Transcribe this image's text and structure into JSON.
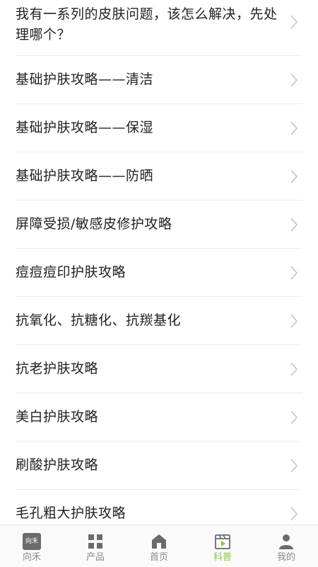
{
  "list": {
    "items": [
      {
        "label": "我有一系列的皮肤问题，该怎么解决，先处理哪个？"
      },
      {
        "label": "基础护肤攻略——清洁"
      },
      {
        "label": "基础护肤攻略——保湿"
      },
      {
        "label": "基础护肤攻略——防晒"
      },
      {
        "label": "屏障受损/敏感皮修护攻略"
      },
      {
        "label": "痘痘痘印护肤攻略"
      },
      {
        "label": "抗氧化、抗糖化、抗羰基化"
      },
      {
        "label": "抗老护肤攻略"
      },
      {
        "label": "美白护肤攻略"
      },
      {
        "label": "刷酸护肤攻略"
      },
      {
        "label": "毛孔粗大护肤攻略"
      }
    ]
  },
  "tabbar": {
    "logo_text": "向禾",
    "tabs": [
      {
        "label": "向禾",
        "icon": "logo-icon"
      },
      {
        "label": "产品",
        "icon": "grid-icon"
      },
      {
        "label": "首页",
        "icon": "home-icon"
      },
      {
        "label": "科普",
        "icon": "clapper-icon"
      },
      {
        "label": "我的",
        "icon": "person-icon"
      }
    ]
  },
  "colors": {
    "active": "#8cc63f",
    "inactive": "#8a8a8a",
    "icon": "#6b6b6b"
  }
}
